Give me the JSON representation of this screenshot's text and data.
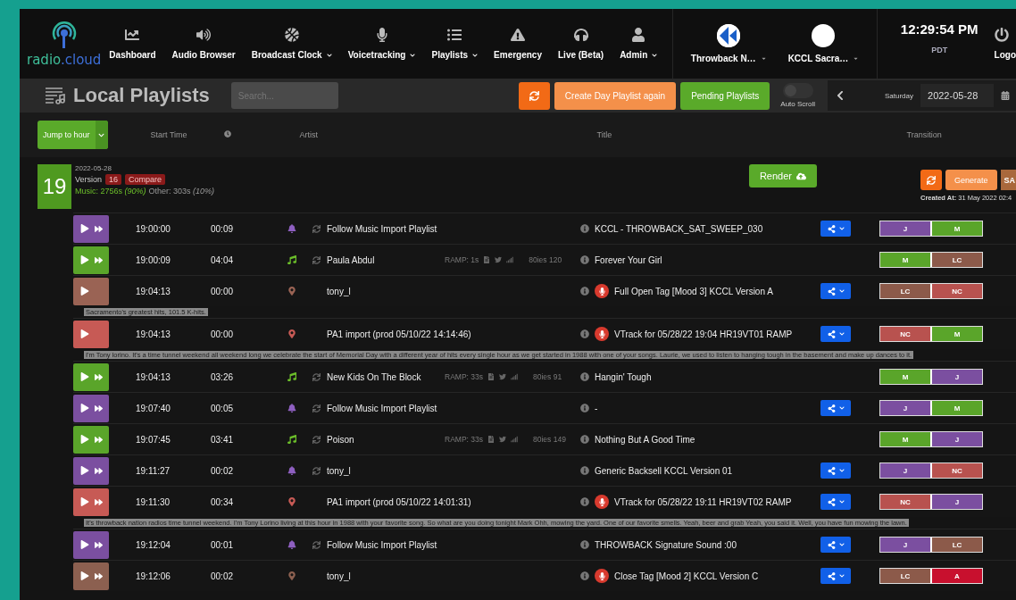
{
  "nav": {
    "logo": {
      "name": "radio",
      "suffix": ".cloud"
    },
    "items": [
      {
        "label": "Dashboard",
        "dropdown": false
      },
      {
        "label": "Audio Browser",
        "dropdown": false
      },
      {
        "label": "Broadcast Clock",
        "dropdown": true
      },
      {
        "label": "Voicetracking",
        "dropdown": true
      },
      {
        "label": "Playlists",
        "dropdown": true
      },
      {
        "label": "Emergency",
        "dropdown": false
      },
      {
        "label": "Live (Beta)",
        "dropdown": false
      },
      {
        "label": "Admin",
        "dropdown": true
      }
    ],
    "stations": [
      {
        "label": "Throwback N…",
        "kind": "logo"
      },
      {
        "label": "KCCL Sacra…",
        "kind": "blank"
      }
    ],
    "clock": {
      "time": "12:29:54 PM",
      "zone": "PDT"
    },
    "logout": "Logo"
  },
  "toolbar": {
    "title": "Local Playlists",
    "search": {
      "placeholder": "Search..."
    },
    "create": "Create Day Playlist again",
    "pending": "Pending Playlists",
    "auto_scroll": {
      "label": "Auto Scroll",
      "on": false
    },
    "day": "Saturday",
    "date": "2022-05-28"
  },
  "columns": {
    "jump": "Jump to hour",
    "start": "Start Time",
    "artist": "Artist",
    "title": "Title",
    "transition": "Transition"
  },
  "hour": {
    "number": "19",
    "date": "2022-05-28",
    "version_label": "Version",
    "version": "16",
    "compare": "Compare",
    "music": "Music: 2756s *(90%)*",
    "other": "Other: 303s *(10%)*",
    "render": "Render",
    "generate": "Generate",
    "save": "SA",
    "created_label": "Created At:",
    "created": "31 May 2022 02:4"
  },
  "rows": [
    {
      "kind": "bell",
      "color": "#7b4fa0",
      "skip": true,
      "start": "19:00:00",
      "duration": "00:09",
      "sync": true,
      "artist": "Follow Music Import Playlist",
      "title": "KCCL - THROWBACK_SAT_SWEEP_030",
      "alert": false,
      "share": true,
      "transition": [
        {
          "label": "J",
          "color": "#7b4fa0"
        },
        {
          "label": "M",
          "color": "#5aa52a"
        }
      ]
    },
    {
      "kind": "music",
      "color": "#5aa52a",
      "skip": true,
      "start": "19:00:09",
      "duration": "04:04",
      "sync": true,
      "artist": "Paula Abdul",
      "ramp": "RAMP: 1s",
      "genre": "80ies 120",
      "title": "Forever Your Girl",
      "alert": false,
      "share": false,
      "transition": [
        {
          "label": "M",
          "color": "#5aa52a"
        },
        {
          "label": "LC",
          "color": "#8c5a4a"
        }
      ]
    },
    {
      "kind": "pin",
      "color": "#9a6354",
      "skip": false,
      "start": "19:04:13",
      "duration": "00:00",
      "sync": false,
      "artist": "tony_l",
      "title": "Full Open Tag [Mood 3] KCCL Version A",
      "alert": true,
      "share": true,
      "transition": [
        {
          "label": "LC",
          "color": "#8c5a4a"
        },
        {
          "label": "NC",
          "color": "#b8524f"
        }
      ]
    },
    {
      "kind": "transcript",
      "text": "Sacramento's greatest hits, 101.5 K-hits."
    },
    {
      "kind": "pin",
      "color": "#c75a55",
      "skip": false,
      "start": "19:04:13",
      "duration": "00:00",
      "sync": false,
      "artist": "PA1 import (prod 05/10/22 14:14:46)",
      "title": "VTrack for 05/28/22 19:04 HR19VT01 RAMP",
      "alert": true,
      "share": true,
      "transition": [
        {
          "label": "NC",
          "color": "#b8524f"
        },
        {
          "label": "M",
          "color": "#5aa52a"
        }
      ]
    },
    {
      "kind": "transcript",
      "text": "I'm Tony lorino. It's a time tunnel weekend all weekend long we celebrate the start of Memorial Day with a different year of hits every single hour as we get started in 1988 with one of your songs. Laurie, we used to listen to hanging tough in the basement and make up dances to it."
    },
    {
      "kind": "music",
      "color": "#5aa52a",
      "skip": true,
      "start": "19:04:13",
      "duration": "03:26",
      "sync": true,
      "artist": "New Kids On The Block",
      "ramp": "RAMP: 33s",
      "genre": "80ies 91",
      "title": "Hangin' Tough",
      "alert": false,
      "share": false,
      "transition": [
        {
          "label": "M",
          "color": "#5aa52a"
        },
        {
          "label": "J",
          "color": "#7b4fa0"
        }
      ]
    },
    {
      "kind": "bell",
      "color": "#7b4fa0",
      "skip": true,
      "start": "19:07:40",
      "duration": "00:05",
      "sync": true,
      "artist": "Follow Music Import Playlist",
      "title": "-",
      "alert": false,
      "share": true,
      "transition": [
        {
          "label": "J",
          "color": "#7b4fa0"
        },
        {
          "label": "M",
          "color": "#5aa52a"
        }
      ]
    },
    {
      "kind": "music",
      "color": "#5aa52a",
      "skip": true,
      "start": "19:07:45",
      "duration": "03:41",
      "sync": true,
      "artist": "Poison",
      "ramp": "RAMP: 33s",
      "genre": "80ies 149",
      "title": "Nothing But A Good Time",
      "alert": false,
      "share": false,
      "transition": [
        {
          "label": "M",
          "color": "#5aa52a"
        },
        {
          "label": "J",
          "color": "#7b4fa0"
        }
      ]
    },
    {
      "kind": "bell",
      "color": "#7b4fa0",
      "skip": true,
      "start": "19:11:27",
      "duration": "00:02",
      "sync": true,
      "artist": "tony_l",
      "title": "Generic Backsell KCCL Version 01",
      "alert": false,
      "share": true,
      "transition": [
        {
          "label": "J",
          "color": "#7b4fa0"
        },
        {
          "label": "NC",
          "color": "#b8524f"
        }
      ]
    },
    {
      "kind": "pin",
      "color": "#c75a55",
      "skip": true,
      "start": "19:11:30",
      "duration": "00:34",
      "sync": false,
      "artist": "PA1 import (prod 05/10/22 14:01:31)",
      "title": "VTrack for 05/28/22 19:11 HR19VT02 RAMP",
      "alert": true,
      "share": true,
      "transition": [
        {
          "label": "NC",
          "color": "#b8524f"
        },
        {
          "label": "J",
          "color": "#7b4fa0"
        }
      ]
    },
    {
      "kind": "transcript",
      "text": "It's throwback nation radios time tunnel weekend. I'm Tony Lorino living at this hour in 1988 with your favorite song. So what are you doing tonight Mark Ohh, mowing the yard. One of our favorite smells. Yeah, beer and grab Yeah, you said it. Well, you have fun mowing the lawn."
    },
    {
      "kind": "bell",
      "color": "#7b4fa0",
      "skip": true,
      "start": "19:12:04",
      "duration": "00:01",
      "sync": true,
      "artist": "Follow Music Import Playlist",
      "title": "THROWBACK Signature Sound :00",
      "alert": false,
      "share": true,
      "transition": [
        {
          "label": "J",
          "color": "#7b4fa0"
        },
        {
          "label": "LC",
          "color": "#8c5a4a"
        }
      ]
    },
    {
      "kind": "pin",
      "color": "#8c6050",
      "skip": true,
      "start": "19:12:06",
      "duration": "00:02",
      "sync": false,
      "artist": "tony_l",
      "title": "Close Tag [Mood 2] KCCL Version C",
      "alert": true,
      "share": true,
      "transition": [
        {
          "label": "LC",
          "color": "#8c5a4a"
        },
        {
          "label": "A",
          "color": "#c8102e"
        }
      ]
    }
  ]
}
